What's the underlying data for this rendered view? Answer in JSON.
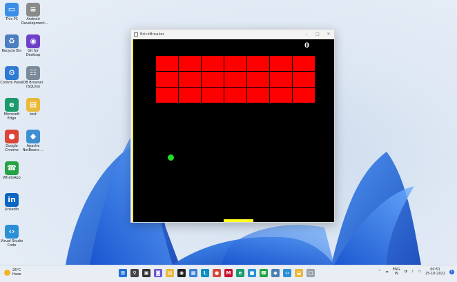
{
  "desktop": {
    "icons": [
      {
        "label": "This PC",
        "glyph": "▭",
        "color": "#3a8ee6"
      },
      {
        "label": "Android Development...",
        "glyph": "≡",
        "color": "#8a8a8a"
      },
      {
        "label": "Recycle Bin",
        "glyph": "♻",
        "color": "#4b7fbf"
      },
      {
        "label": "Git for Desktop",
        "glyph": "◉",
        "color": "#6e40c9"
      },
      {
        "label": "Control Panel",
        "glyph": "⚙",
        "color": "#2f7bd1"
      },
      {
        "label": "DB Browser (SQLite)",
        "glyph": "☷",
        "color": "#7a8a99"
      },
      {
        "label": "Microsoft Edge",
        "glyph": "e",
        "color": "#1a9a6d"
      },
      {
        "label": "test",
        "glyph": "▤",
        "color": "#e8b93a"
      },
      {
        "label": "Google Chrome",
        "glyph": "●",
        "color": "#db4437"
      },
      {
        "label": "Apache NetBeans ...",
        "glyph": "◆",
        "color": "#3d8fd1"
      },
      {
        "label": "WhatsApp",
        "glyph": "☎",
        "color": "#25a244"
      },
      {
        "label": "LinkedIn",
        "glyph": "in",
        "color": "#0a66c2"
      },
      {
        "label": "Visual Studio Code",
        "glyph": "‹›",
        "color": "#2b8fd6"
      }
    ]
  },
  "window": {
    "title": "BrickBreaker",
    "controls": {
      "minimize": "–",
      "maximize": "□",
      "close": "✕"
    }
  },
  "game": {
    "score": "0",
    "brick_rows": 3,
    "brick_cols": 7,
    "colors": {
      "background": "#000000",
      "brick": "#ff0000",
      "ball": "#1fe01f",
      "paddle": "#ffff1f"
    }
  },
  "taskbar": {
    "weather": {
      "temp": "26°C",
      "condition": "Haze"
    },
    "apps": [
      {
        "name": "start-icon",
        "glyph": "⊞",
        "color": "#1e6fd9"
      },
      {
        "name": "search-icon",
        "glyph": "⚲",
        "color": "#444444"
      },
      {
        "name": "task-view-icon",
        "glyph": "▣",
        "color": "#333333"
      },
      {
        "name": "chat-icon",
        "glyph": "◙",
        "color": "#6a5acd"
      },
      {
        "name": "file-explorer-icon",
        "glyph": "▤",
        "color": "#e8b93a"
      },
      {
        "name": "github-icon",
        "glyph": "◉",
        "color": "#222222"
      },
      {
        "name": "store-icon",
        "glyph": "▦",
        "color": "#3a7fd5"
      },
      {
        "name": "linkedin-icon",
        "glyph": "L",
        "color": "#0a8fc2"
      },
      {
        "name": "chrome-icon",
        "glyph": "●",
        "color": "#db4437"
      },
      {
        "name": "mcafee-icon",
        "glyph": "M",
        "color": "#c8102e"
      },
      {
        "name": "edge-icon",
        "glyph": "e",
        "color": "#1a9a6d"
      },
      {
        "name": "blue-app-icon",
        "glyph": "■",
        "color": "#2b8fd6"
      },
      {
        "name": "whatsapp-icon",
        "glyph": "☎",
        "color": "#25a244"
      },
      {
        "name": "bluej-icon",
        "glyph": "◆",
        "color": "#4a7fb0"
      },
      {
        "name": "vscode-icon",
        "glyph": "‹›",
        "color": "#2b8fd6"
      },
      {
        "name": "python-icon",
        "glyph": "◒",
        "color": "#e8b93a"
      },
      {
        "name": "brickbreaker-icon",
        "glyph": "□",
        "color": "#9aa3ad"
      }
    ],
    "tray": {
      "language": "ENG",
      "region": "IN",
      "time": "00:51",
      "date": "25-10-2022",
      "notifications": "1"
    }
  }
}
